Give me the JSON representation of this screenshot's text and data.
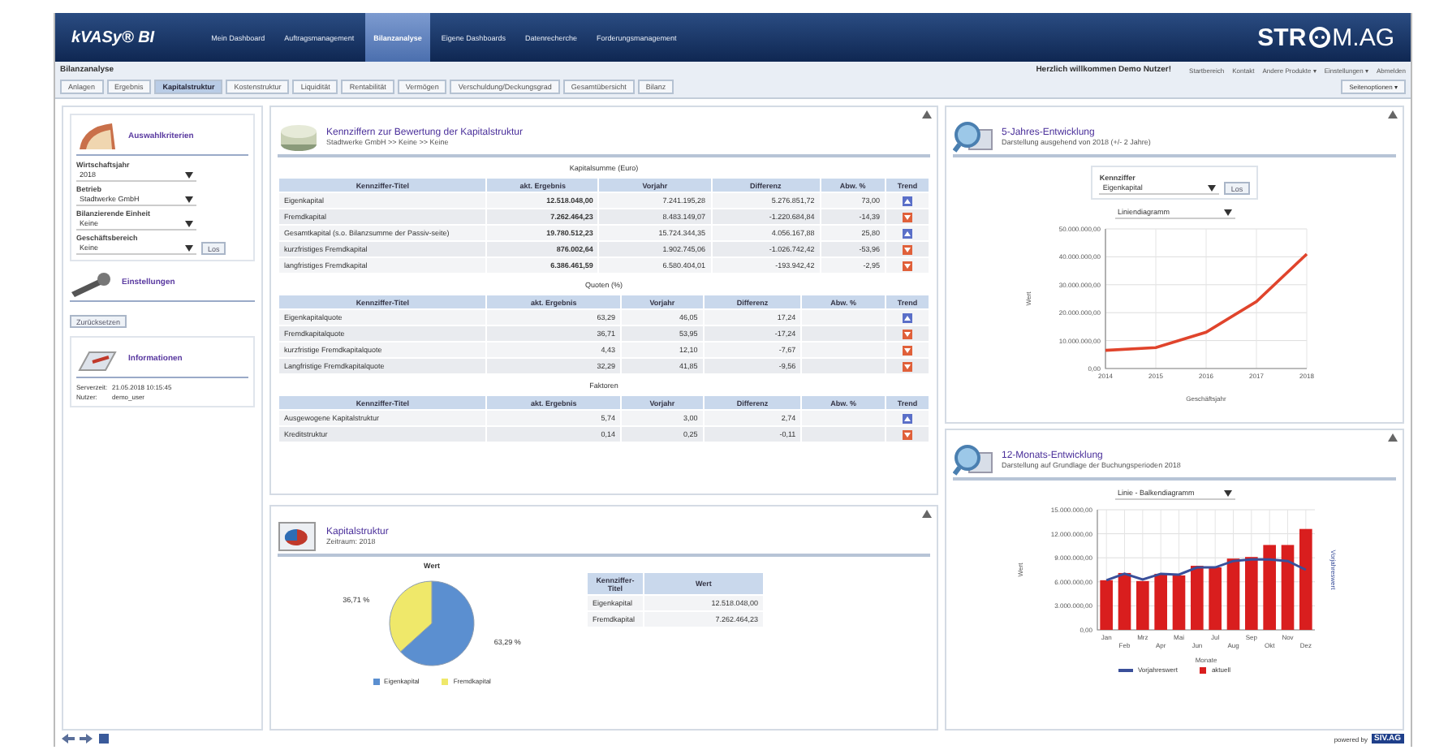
{
  "header": {
    "logo": "kVASy® BI",
    "nav": [
      {
        "label": "Mein Dashboard",
        "selected": false
      },
      {
        "label": "Auftragsmanagement",
        "selected": false
      },
      {
        "label": "Bilanzanalyse",
        "selected": true
      },
      {
        "label": "Eigene Dashboards",
        "selected": false
      },
      {
        "label": "Datenrecherche",
        "selected": false
      },
      {
        "label": "Forderungsmanagement",
        "selected": false
      }
    ],
    "brand_left": "STR",
    "brand_right": "M.AG"
  },
  "subbar": {
    "page_title": "Bilanzanalyse",
    "welcome": "Herzlich willkommen Demo Nutzer!",
    "links": [
      "Startbereich",
      "Kontakt",
      "Andere Produkte ▾",
      "Einstellungen ▾",
      "Abmelden"
    ],
    "tabs": [
      {
        "label": "Anlagen",
        "selected": false
      },
      {
        "label": "Ergebnis",
        "selected": false
      },
      {
        "label": "Kapitalstruktur",
        "selected": true
      },
      {
        "label": "Kostenstruktur",
        "selected": false
      },
      {
        "label": "Liquidität",
        "selected": false
      },
      {
        "label": "Rentabilität",
        "selected": false
      },
      {
        "label": "Vermögen",
        "selected": false
      },
      {
        "label": "Verschuldung/Deckungsgrad",
        "selected": false
      },
      {
        "label": "Gesamtübersicht",
        "selected": false
      },
      {
        "label": "Bilanz",
        "selected": false
      }
    ],
    "options_button": "Seitenoptionen ▾"
  },
  "sidebar": {
    "criteria": {
      "title": "Auswahlkriterien",
      "fields": [
        {
          "label": "Wirtschaftsjahr",
          "value": "2018"
        },
        {
          "label": "Betrieb",
          "value": "Stadtwerke GmbH"
        },
        {
          "label": "Bilanzierende Einheit",
          "value": "Keine"
        },
        {
          "label": "Geschäftsbereich",
          "value": "Keine"
        }
      ],
      "go_button": "Los"
    },
    "settings": {
      "title": "Einstellungen",
      "reset_button": "Zurücksetzen"
    },
    "info": {
      "title": "Informationen",
      "rows": [
        {
          "label": "Serverzeit:",
          "value": "21.05.2018 10:15:45"
        },
        {
          "label": "Nutzer:",
          "value": "demo_user"
        }
      ]
    }
  },
  "key_figures": {
    "title": "Kennziffern zur Bewertung der Kapitalstruktur",
    "subtitle": "Stadtwerke GmbH >> Keine >> Keine",
    "tables": [
      {
        "caption": "Kapitalsumme (Euro)",
        "columns": [
          "Kennziffer-Titel",
          "akt. Ergebnis",
          "Vorjahr",
          "Differenz",
          "Abw. %",
          "Trend"
        ],
        "rows": [
          {
            "cells": [
              "Eigenkapital",
              "12.518.048,00",
              "7.241.195,28",
              "5.276.851,72",
              "73,00"
            ],
            "rising": true
          },
          {
            "cells": [
              "Fremdkapital",
              "7.262.464,23",
              "8.483.149,07",
              "-1.220.684,84",
              "-14,39"
            ],
            "rising": false
          },
          {
            "cells": [
              "Gesamtkapital (s.o. Bilanzsumme der Passiv-seite)",
              "19.780.512,23",
              "15.724.344,35",
              "4.056.167,88",
              "25,80"
            ],
            "rising": true
          },
          {
            "cells": [
              "kurzfristiges Fremdkapital",
              "876.002,64",
              "1.902.745,06",
              "-1.026.742,42",
              "-53,96"
            ],
            "rising": false
          },
          {
            "cells": [
              "langfristiges Fremdkapital",
              "6.386.461,59",
              "6.580.404,01",
              "-193.942,42",
              "-2,95"
            ],
            "rising": false
          }
        ]
      },
      {
        "caption": "Quoten (%)",
        "columns": [
          "Kennziffer-Titel",
          "akt. Ergebnis",
          "Vorjahr",
          "Differenz",
          "Abw. %",
          "Trend"
        ],
        "rows": [
          {
            "cells": [
              "Eigenkapitalquote",
              "63,29",
              "46,05",
              "17,24",
              ""
            ],
            "rising": true
          },
          {
            "cells": [
              "Fremdkapitalquote",
              "36,71",
              "53,95",
              "-17,24",
              ""
            ],
            "rising": false
          },
          {
            "cells": [
              "kurzfristige Fremdkapitalquote",
              "4,43",
              "12,10",
              "-7,67",
              ""
            ],
            "rising": false
          },
          {
            "cells": [
              "Langfristige Fremdkapitalquote",
              "32,29",
              "41,85",
              "-9,56",
              ""
            ],
            "rising": false
          }
        ]
      },
      {
        "caption": "Faktoren",
        "columns": [
          "Kennziffer-Titel",
          "akt. Ergebnis",
          "Vorjahr",
          "Differenz",
          "Abw. %",
          "Trend"
        ],
        "rows": [
          {
            "cells": [
              "Ausgewogene Kapitalstruktur",
              "5,74",
              "3,00",
              "2,74",
              ""
            ],
            "rising": true
          },
          {
            "cells": [
              "Kreditstruktur",
              "0,14",
              "0,25",
              "-0,11",
              ""
            ],
            "rising": false
          }
        ]
      }
    ]
  },
  "structure": {
    "title": "Kapitalstruktur",
    "subtitle": "Zeitraum: 2018",
    "chart_data": {
      "type": "pie",
      "title": "Wert",
      "legend": "bottom",
      "categories": [
        "Eigenkapital",
        "Fremdkapital"
      ],
      "series": [
        {
          "values": [
            63.29,
            36.71
          ]
        }
      ],
      "colors": [
        "#5b8fd0",
        "#efe86a"
      ],
      "value_labels": [
        "63,29 %",
        "36,71 %"
      ]
    },
    "table": {
      "columns": [
        "Kennziffer-Titel",
        "Wert"
      ],
      "rows": [
        [
          "Eigenkapital",
          "12.518.048,00"
        ],
        [
          "Fremdkapital",
          "7.262.464,23"
        ]
      ]
    }
  },
  "five_year": {
    "title": "5-Jahres-Entwicklung",
    "subtitle": "Darstellung ausgehend von 2018 (+/- 2 Jahre)",
    "figure_label": "Kennziffer",
    "figure_value": "Eigenkapital",
    "go_button": "Los",
    "chart_type": "Liniendiagramm",
    "chart_data": {
      "type": "line",
      "grid": true,
      "xlabel": "Geschäftsjahr",
      "ylabel": "Wert",
      "categories": [
        "2014",
        "2015",
        "2016",
        "2017",
        "2018"
      ],
      "series": [
        {
          "color": "#e0442c",
          "values": [
            6500000,
            7500000,
            13000000,
            24000000,
            41000000
          ]
        }
      ],
      "ylim": [
        0,
        50000000
      ],
      "yticks": [
        {
          "value": 0,
          "label": "0,00"
        },
        {
          "value": 10000000,
          "label": "10.000.000,00"
        },
        {
          "value": 20000000,
          "label": "20.000.000,00"
        },
        {
          "value": 30000000,
          "label": "30.000.000,00"
        },
        {
          "value": 40000000,
          "label": "40.000.000,00"
        },
        {
          "value": 50000000,
          "label": "50.000.000,00"
        }
      ]
    }
  },
  "twelve_month": {
    "title": "12-Monats-Entwicklung",
    "subtitle": "Darstellung auf Grundlage der Buchungsperioden 2018",
    "chart_type": "Linie - Balkendiagramm",
    "right_axis_label": "Vorjahreswert",
    "chart_data": {
      "type": "bar",
      "grid": true,
      "legend": "bottom",
      "xlabel": "Monate",
      "ylabel": "Wert",
      "categories": [
        "Jan",
        "Feb",
        "Mrz",
        "Apr",
        "Mai",
        "Jun",
        "Jul",
        "Aug",
        "Sep",
        "Okt",
        "Nov",
        "Dez"
      ],
      "series": [
        {
          "name": "Vorjahreswert",
          "type": "line",
          "color": "#3a4f9a",
          "values": [
            6200000,
            7000000,
            6300000,
            7000000,
            6900000,
            7800000,
            7800000,
            8600000,
            8800000,
            8800000,
            8600000,
            7500000
          ]
        },
        {
          "name": "aktuell",
          "type": "bar",
          "color": "#d91e1e",
          "values": [
            6200000,
            7100000,
            6100000,
            7000000,
            6800000,
            8000000,
            7800000,
            8900000,
            9100000,
            10600000,
            10600000,
            12600000
          ]
        }
      ],
      "ylim": [
        0,
        15000000
      ],
      "yticks": [
        {
          "value": 0,
          "label": "0,00"
        },
        {
          "value": 3000000,
          "label": "3.000.000,00"
        },
        {
          "value": 6000000,
          "label": "6.000.000,00"
        },
        {
          "value": 9000000,
          "label": "9.000.000,00"
        },
        {
          "value": 12000000,
          "label": "12.000.000,00"
        },
        {
          "value": 15000000,
          "label": "15.000.000,00"
        }
      ]
    }
  },
  "footer": {
    "powered_by": "powered by",
    "vendor": "SIV.AG"
  }
}
